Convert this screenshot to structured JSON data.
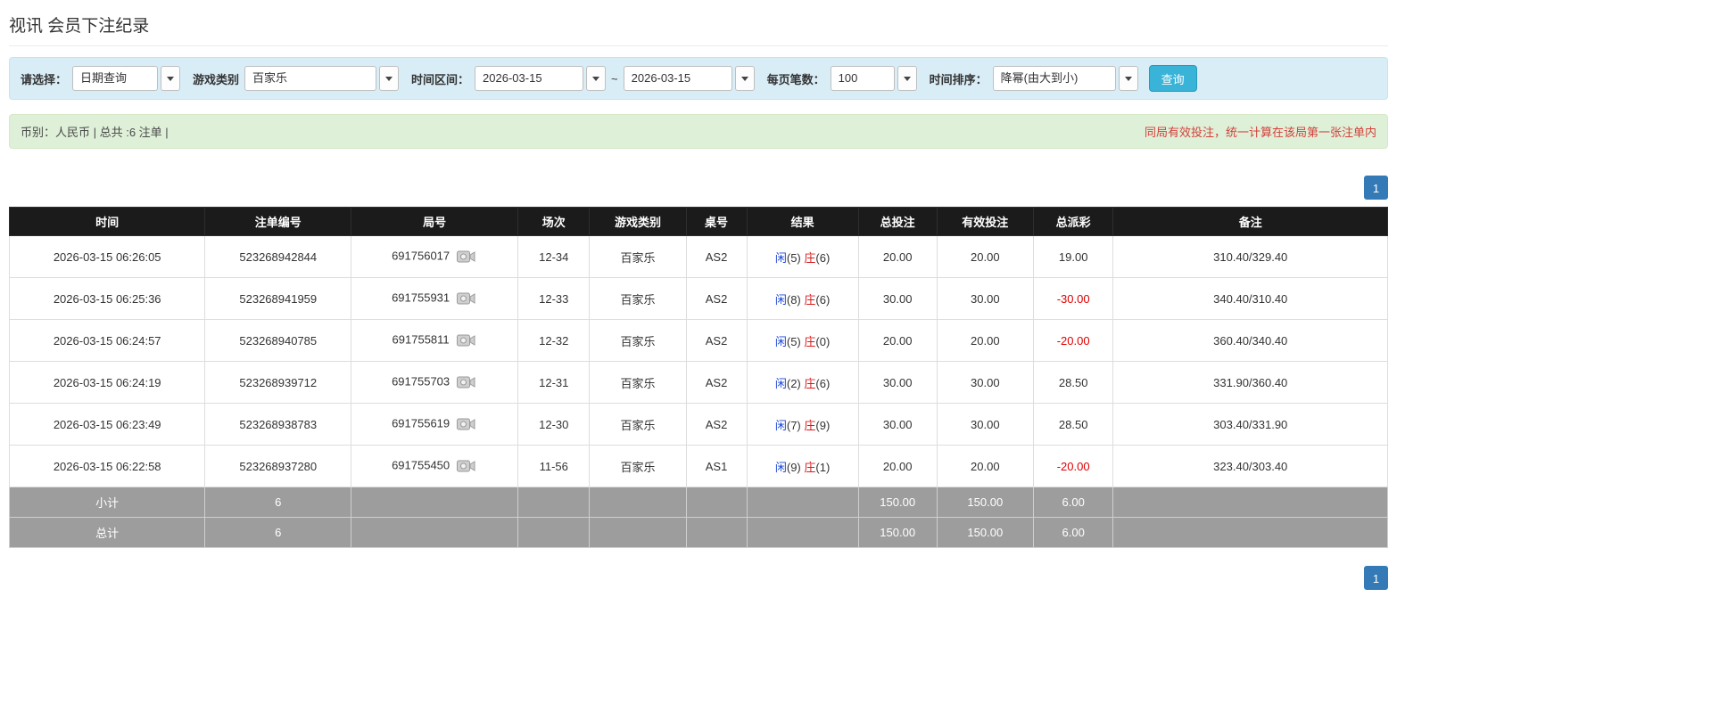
{
  "page": {
    "title": "视讯 会员下注纪录"
  },
  "filters": {
    "select_label": "请选择：",
    "select_value": "日期查询",
    "game_label": "游戏类别",
    "game_value": "百家乐",
    "range_label": "时间区间：",
    "date_from": "2026-03-15",
    "tilde": "~",
    "date_to": "2026-03-15",
    "page_size_label": "每页笔数：",
    "page_size_value": "100",
    "sort_label": "时间排序：",
    "sort_value": "降幂(由大到小)",
    "search_label": "查询"
  },
  "summary": {
    "left": "币别：人民币 | 总共 :6 注单 |",
    "right": "同局有效投注，统一计算在该局第一张注单内"
  },
  "pagination": {
    "current": "1"
  },
  "colors": {
    "accent_blue": "#337ab7",
    "player_blue": "#1a46d8",
    "banker_red": "#d81a1a",
    "negative_red": "#e00000",
    "search_button_blue": "#39b3d7",
    "header_black": "#1b1b1b",
    "footer_gray": "#9d9d9d",
    "filter_bar_blue": "#d9edf7",
    "summary_bar_green": "#dff0d8"
  },
  "table": {
    "headers": [
      "时间",
      "注单编号",
      "局号",
      "场次",
      "游戏类别",
      "桌号",
      "结果",
      "总投注",
      "有效投注",
      "总派彩",
      "备注"
    ],
    "rows": [
      {
        "time": "2026-03-15 06:26:05",
        "bet_id": "523268942844",
        "round_id": "691756017",
        "session": "12-34",
        "game": "百家乐",
        "table_no": "AS2",
        "player_label": "闲",
        "player_num": "(5)",
        "banker_label": "庄",
        "banker_num": "(6)",
        "total_bet": "20.00",
        "valid_bet": "20.00",
        "payout": "19.00",
        "note": "310.40/329.40"
      },
      {
        "time": "2026-03-15 06:25:36",
        "bet_id": "523268941959",
        "round_id": "691755931",
        "session": "12-33",
        "game": "百家乐",
        "table_no": "AS2",
        "player_label": "闲",
        "player_num": "(8)",
        "banker_label": "庄",
        "banker_num": "(6)",
        "total_bet": "30.00",
        "valid_bet": "30.00",
        "payout": "-30.00",
        "note": "340.40/310.40"
      },
      {
        "time": "2026-03-15 06:24:57",
        "bet_id": "523268940785",
        "round_id": "691755811",
        "session": "12-32",
        "game": "百家乐",
        "table_no": "AS2",
        "player_label": "闲",
        "player_num": "(5)",
        "banker_label": "庄",
        "banker_num": "(0)",
        "total_bet": "20.00",
        "valid_bet": "20.00",
        "payout": "-20.00",
        "note": "360.40/340.40"
      },
      {
        "time": "2026-03-15 06:24:19",
        "bet_id": "523268939712",
        "round_id": "691755703",
        "session": "12-31",
        "game": "百家乐",
        "table_no": "AS2",
        "player_label": "闲",
        "player_num": "(2)",
        "banker_label": "庄",
        "banker_num": "(6)",
        "total_bet": "30.00",
        "valid_bet": "30.00",
        "payout": "28.50",
        "note": "331.90/360.40"
      },
      {
        "time": "2026-03-15 06:23:49",
        "bet_id": "523268938783",
        "round_id": "691755619",
        "session": "12-30",
        "game": "百家乐",
        "table_no": "AS2",
        "player_label": "闲",
        "player_num": "(7)",
        "banker_label": "庄",
        "banker_num": "(9)",
        "total_bet": "30.00",
        "valid_bet": "30.00",
        "payout": "28.50",
        "note": "303.40/331.90"
      },
      {
        "time": "2026-03-15 06:22:58",
        "bet_id": "523268937280",
        "round_id": "691755450",
        "session": "11-56",
        "game": "百家乐",
        "table_no": "AS1",
        "player_label": "闲",
        "player_num": "(9)",
        "banker_label": "庄",
        "banker_num": "(1)",
        "total_bet": "20.00",
        "valid_bet": "20.00",
        "payout": "-20.00",
        "note": "323.40/303.40"
      }
    ],
    "subtotal": {
      "label": "小计",
      "count": "6",
      "total_bet": "150.00",
      "valid_bet": "150.00",
      "payout": "6.00"
    },
    "grand_total": {
      "label": "总计",
      "count": "6",
      "total_bet": "150.00",
      "valid_bet": "150.00",
      "payout": "6.00"
    }
  }
}
